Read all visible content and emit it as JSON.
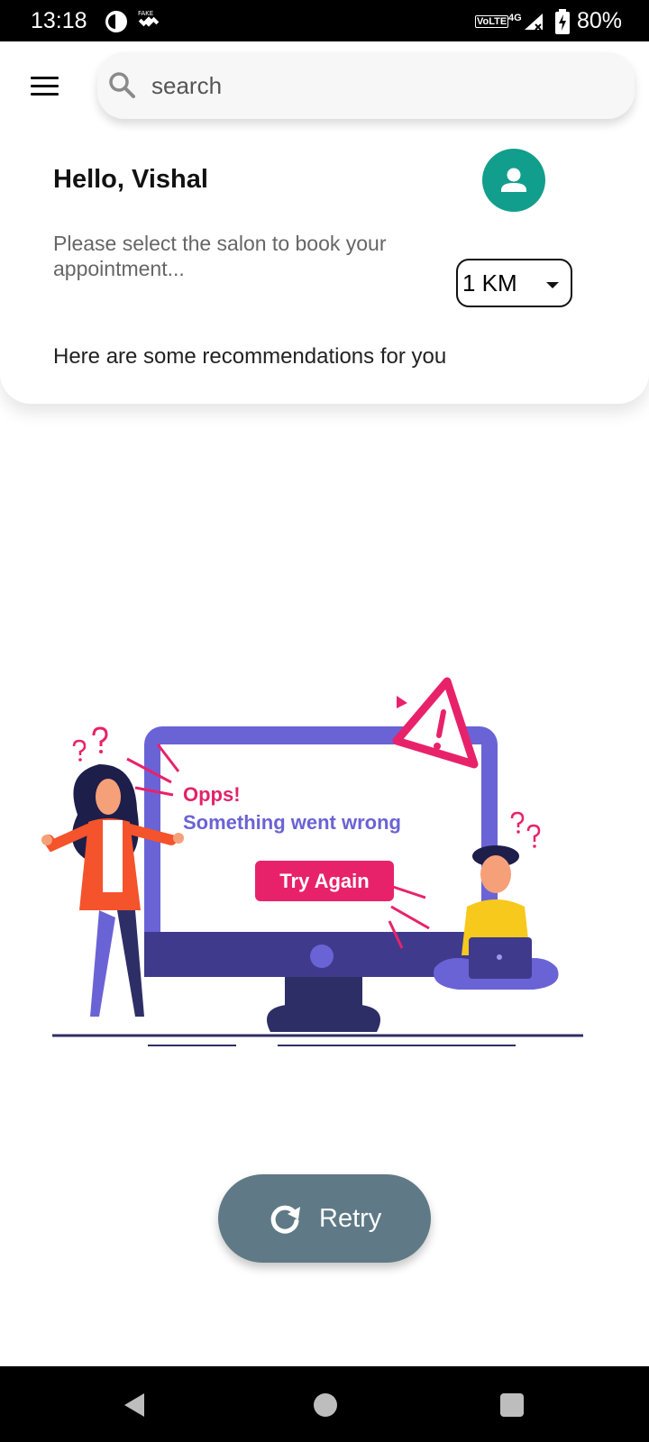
{
  "status_bar": {
    "time": "13:18",
    "network_label": "VoLTE",
    "network_type": "4G",
    "battery": "80%",
    "icons": [
      "circle-app-icon",
      "fake-gps-icon",
      "signal-icon",
      "battery-icon"
    ]
  },
  "header": {
    "menu_icon": "hamburger-menu-icon",
    "search": {
      "placeholder": "search",
      "icon": "search-icon"
    },
    "greeting": "Hello, Vishal",
    "avatar_icon": "person-icon",
    "avatar_color": "#129e8c",
    "subtitle": "Please select the salon to book your appointment...",
    "distance_select": {
      "value": "1 KM",
      "icon": "dropdown-arrow-icon"
    },
    "recommendations": "Here are some recommendations for you"
  },
  "error_illustration": {
    "title": "Opps!",
    "message": "Something went wrong",
    "button_label": "Try Again",
    "accent_pink": "#e8226a",
    "accent_purple": "#6a63d6"
  },
  "retry": {
    "label": "Retry",
    "icon": "refresh-icon",
    "color": "#5f7a86"
  },
  "nav_bar": {
    "icons": [
      "back-triangle-icon",
      "home-circle-icon",
      "recents-square-icon"
    ]
  }
}
